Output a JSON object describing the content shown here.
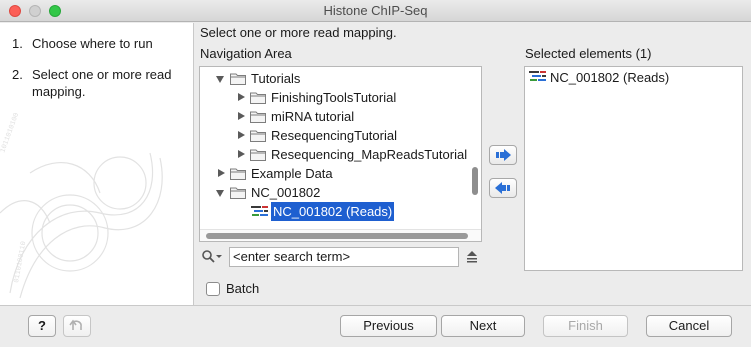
{
  "window": {
    "title": "Histone ChIP-Seq"
  },
  "steps": [
    {
      "num": "1.",
      "label": "Choose where to run"
    },
    {
      "num": "2.",
      "label": "Select one or more read mapping."
    }
  ],
  "instruction": "Select one or more read mapping.",
  "navigation": {
    "label": "Navigation Area",
    "tree": [
      {
        "label": "Tutorials",
        "expanded": true,
        "icon": "folder-icon"
      },
      {
        "label": "FinishingToolsTutorial",
        "expanded": false,
        "icon": "folder-icon"
      },
      {
        "label": "miRNA tutorial",
        "expanded": false,
        "icon": "folder-icon"
      },
      {
        "label": "ResequencingTutorial",
        "expanded": false,
        "icon": "folder-icon"
      },
      {
        "label": "Resequencing_MapReadsTutorial",
        "expanded": false,
        "icon": "folder-icon"
      },
      {
        "label": "Example Data",
        "expanded": false,
        "icon": "folder-icon"
      },
      {
        "label": "NC_001802",
        "expanded": true,
        "icon": "folder-icon"
      },
      {
        "label": "NC_001802 (Reads)",
        "selected": true,
        "icon": "reads-icon"
      }
    ]
  },
  "search": {
    "placeholder": "<enter search term>"
  },
  "batch": {
    "label": "Batch",
    "checked": false
  },
  "selected": {
    "label": "Selected elements (1)",
    "items": [
      {
        "label": "NC_001802 (Reads)",
        "icon": "reads-icon"
      }
    ]
  },
  "buttons": {
    "help": "?",
    "previous": "Previous",
    "next": "Next",
    "finish": "Finish",
    "cancel": "Cancel"
  },
  "colors": {
    "selection": "#1e5fd0",
    "move_arrow": "#2a6fd6"
  }
}
